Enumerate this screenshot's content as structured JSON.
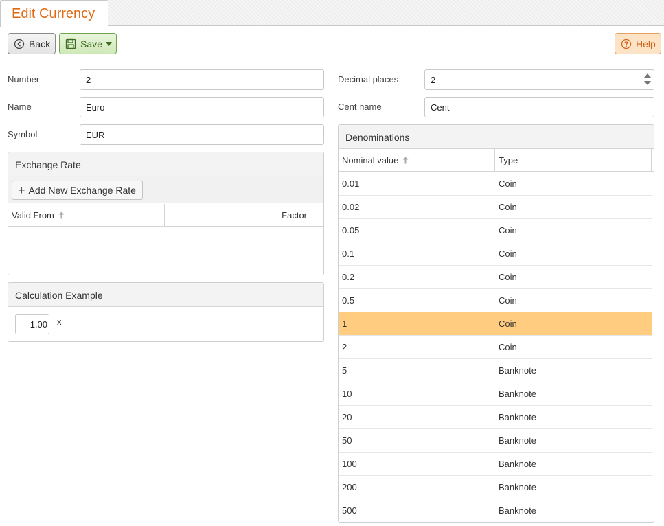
{
  "tab": {
    "title": "Edit Currency"
  },
  "toolbar": {
    "back_label": "Back",
    "save_label": "Save",
    "help_label": "Help"
  },
  "form": {
    "number_label": "Number",
    "number_value": "2",
    "name_label": "Name",
    "name_value": "Euro",
    "symbol_label": "Symbol",
    "symbol_value": "EUR",
    "decimal_places_label": "Decimal places",
    "decimal_places_value": "2",
    "cent_name_label": "Cent name",
    "cent_name_value": "Cent"
  },
  "exchange_rate": {
    "title": "Exchange Rate",
    "add_label": "Add New Exchange Rate",
    "columns": [
      "Valid From",
      "Factor"
    ],
    "rows": []
  },
  "calculation": {
    "title": "Calculation Example",
    "amount": "1.00",
    "times": "x",
    "equals": "="
  },
  "denominations": {
    "title": "Denominations",
    "columns": [
      "Nominal value",
      "Type"
    ],
    "selected_index": 6,
    "rows": [
      {
        "value": "0.01",
        "type": "Coin"
      },
      {
        "value": "0.02",
        "type": "Coin"
      },
      {
        "value": "0.05",
        "type": "Coin"
      },
      {
        "value": "0.1",
        "type": "Coin"
      },
      {
        "value": "0.2",
        "type": "Coin"
      },
      {
        "value": "0.5",
        "type": "Coin"
      },
      {
        "value": "1",
        "type": "Coin"
      },
      {
        "value": "2",
        "type": "Coin"
      },
      {
        "value": "5",
        "type": "Banknote"
      },
      {
        "value": "10",
        "type": "Banknote"
      },
      {
        "value": "20",
        "type": "Banknote"
      },
      {
        "value": "50",
        "type": "Banknote"
      },
      {
        "value": "100",
        "type": "Banknote"
      },
      {
        "value": "200",
        "type": "Banknote"
      },
      {
        "value": "500",
        "type": "Banknote"
      }
    ]
  },
  "colors": {
    "accent": "#e06a13",
    "selected_row": "#ffcc80",
    "save_green": "#3d6b1f",
    "help_orange": "#d0651c"
  }
}
